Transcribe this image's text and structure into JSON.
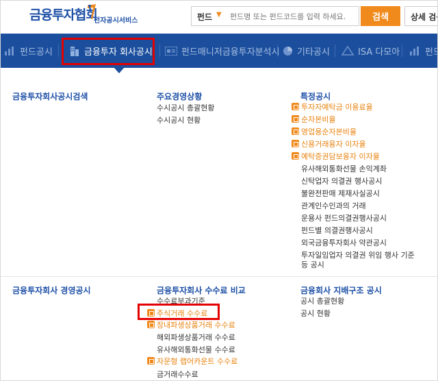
{
  "header": {
    "logo_main": "금융투자협회",
    "logo_sub": "전자공시서비스",
    "search": {
      "select_label": "펀드",
      "placeholder": "펀드명 또는 펀드코드를 입력 하세요.",
      "button_label": "검색"
    },
    "detail_button": "상세 검색"
  },
  "nav": {
    "items": [
      {
        "label": "펀드공시",
        "icon": "bar-chart-icon"
      },
      {
        "label": "금융투자 회사공시",
        "icon": "building-icon",
        "active": true
      },
      {
        "label": "펀드매니저",
        "icon": "card-icon"
      },
      {
        "label": "금융투자분석시",
        "icon": "none"
      },
      {
        "label": "기타공시",
        "icon": "pie-chart-icon"
      },
      {
        "label": "ISA 다모아",
        "icon": "isa-icon"
      },
      {
        "label": "펀드",
        "icon": "bar-chart-icon"
      }
    ]
  },
  "menu": {
    "section1": {
      "col1": {
        "title": "금융투자회사공시검색"
      },
      "col2": {
        "title": "주요경영상황",
        "items": [
          "수시공시 총괄현황",
          "수시공시 현황"
        ]
      },
      "col3": {
        "title": "특정공시",
        "items": [
          {
            "label": "투자자예탁금 이용료율",
            "highlight": true
          },
          {
            "label": "순자본비율",
            "highlight": true
          },
          {
            "label": "영업용순자본비율",
            "highlight": true
          },
          {
            "label": "신용거래융자 이자율",
            "highlight": true
          },
          {
            "label": "예탁증권담보융자 이자율",
            "highlight": true
          },
          {
            "label": "유사해외통화선물 손익계좌",
            "highlight": false
          },
          {
            "label": "신탁업자 의결권 행사공시",
            "highlight": false
          },
          {
            "label": "불완전판매 제재사실공시",
            "highlight": false
          },
          {
            "label": "관계인수인과의 거래",
            "highlight": false
          },
          {
            "label": "운용사 펀드의결권행사공시",
            "highlight": false
          },
          {
            "label": "펀드별 의결권행사공시",
            "highlight": false
          },
          {
            "label": "외국금융투자회사 약관공시",
            "highlight": false
          },
          {
            "label": "투자일임업자 의결권 위임 행사 기준",
            "highlight": false
          },
          {
            "label": "등 공시",
            "highlight": false
          }
        ]
      }
    },
    "section2": {
      "col1": {
        "title": "금융투자회사 경영공시"
      },
      "col2": {
        "title": "금융투자회사 수수료 비교",
        "items": [
          {
            "label": "수수료부과기준",
            "highlight": false
          },
          {
            "label": "주식거래 수수료",
            "highlight": true
          },
          {
            "label": "장내파생상품거래 수수료",
            "highlight": true
          },
          {
            "label": "해외파생상품거래 수수료",
            "highlight": false
          },
          {
            "label": "유사해외통화선물 수수료",
            "highlight": false
          },
          {
            "label": "자문형 랩어카운트 수수료",
            "highlight": true
          },
          {
            "label": "금거래수수료",
            "highlight": false
          }
        ]
      },
      "col3": {
        "title": "금융회사 지배구조 공시",
        "items": [
          "공시 총괄현황",
          "공시 현황"
        ]
      }
    }
  },
  "colors": {
    "nav_bg": "#1b4f9e",
    "accent_orange": "#f08a1c",
    "title_blue": "#1d4fa6",
    "highlight_red": "#e40000"
  }
}
